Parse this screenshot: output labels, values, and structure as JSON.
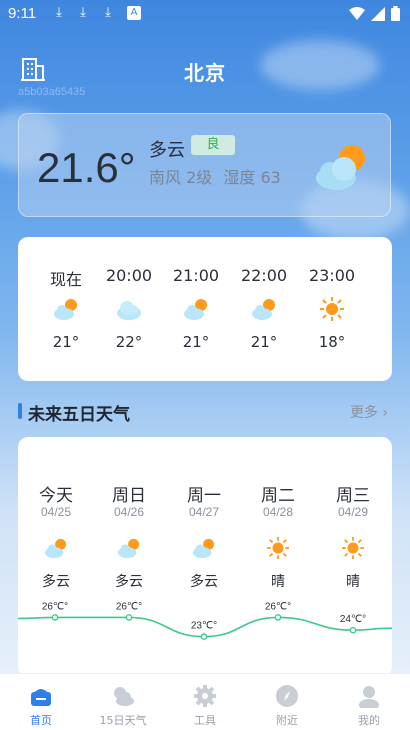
{
  "status_bar": {
    "time": "9:11"
  },
  "header": {
    "city": "北京",
    "faint_id": "a5b03a65435"
  },
  "current": {
    "temperature": "21.6°",
    "condition": "多云",
    "aqi": "良",
    "wind": "南风",
    "wind_level": "2级",
    "humidity_label": "湿度",
    "humidity_value": "63",
    "icon": "partly-cloudy-icon"
  },
  "hourly": [
    {
      "time": "现在",
      "temp": "21°",
      "icon": "partly-cloudy-icon"
    },
    {
      "time": "20:00",
      "temp": "22°",
      "icon": "cloudy-icon"
    },
    {
      "time": "21:00",
      "temp": "21°",
      "icon": "partly-cloudy-icon"
    },
    {
      "time": "22:00",
      "temp": "21°",
      "icon": "partly-cloudy-icon"
    },
    {
      "time": "23:00",
      "temp": "18°",
      "icon": "sunny-icon"
    }
  ],
  "daily_section": {
    "title": "未来五日天气",
    "more": "更多"
  },
  "daily": [
    {
      "day": "今天",
      "date": "04/25",
      "condition": "多云",
      "icon": "partly-cloudy-icon",
      "high": "26℃°"
    },
    {
      "day": "周日",
      "date": "04/26",
      "condition": "多云",
      "icon": "partly-cloudy-icon",
      "high": "26℃°"
    },
    {
      "day": "周一",
      "date": "04/27",
      "condition": "多云",
      "icon": "partly-cloudy-icon",
      "high": "23℃°"
    },
    {
      "day": "周二",
      "date": "04/28",
      "condition": "晴",
      "icon": "sunny-icon",
      "high": "26℃°"
    },
    {
      "day": "周三",
      "date": "04/29",
      "condition": "晴",
      "icon": "sunny-icon",
      "high": "24℃°"
    }
  ],
  "chart_data": {
    "type": "line",
    "categories": [
      "今天",
      "周日",
      "周一",
      "周二",
      "周三"
    ],
    "values": [
      26,
      26,
      23,
      26,
      24
    ],
    "point_labels": [
      "26℃°",
      "26℃°",
      "23℃°",
      "26℃°",
      "24℃°"
    ],
    "ylim": [
      22,
      27
    ],
    "color": "#3cc98a"
  },
  "bottom_nav": [
    {
      "label": "首页",
      "icon": "home-icon",
      "active": true
    },
    {
      "label": "15日天气",
      "icon": "cloud-sun-icon",
      "active": false
    },
    {
      "label": "工具",
      "icon": "gear-icon",
      "active": false
    },
    {
      "label": "附近",
      "icon": "compass-icon",
      "active": false
    },
    {
      "label": "我的",
      "icon": "user-icon",
      "active": false
    }
  ],
  "colors": {
    "accent": "#2f7fe8",
    "aqi_good": "#2fb24e",
    "sun": "#ff9a1a"
  }
}
